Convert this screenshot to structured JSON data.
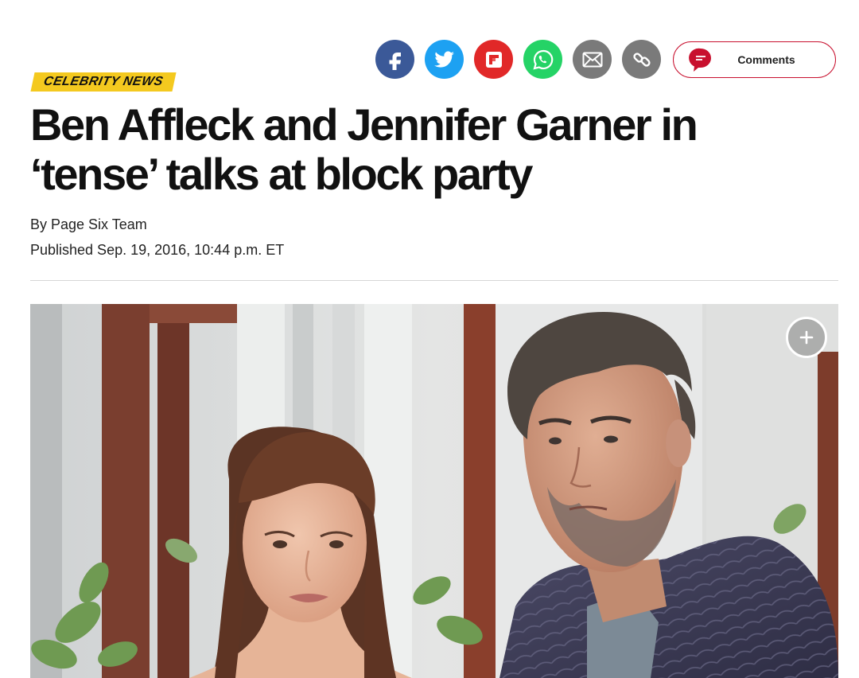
{
  "share": {
    "buttons": [
      {
        "name": "facebook",
        "color": "#3b5998",
        "icon": "facebook-icon"
      },
      {
        "name": "twitter",
        "color": "#1da1f2",
        "icon": "twitter-icon"
      },
      {
        "name": "flipboard",
        "color": "#e12828",
        "icon": "flipboard-icon"
      },
      {
        "name": "whatsapp",
        "color": "#25d366",
        "icon": "whatsapp-icon"
      },
      {
        "name": "email",
        "color": "#7a7a7a",
        "icon": "envelope-icon"
      },
      {
        "name": "copy-link",
        "color": "#7a7a7a",
        "icon": "link-icon"
      }
    ],
    "comments_label": "Comments",
    "comments_color": "#c8102e"
  },
  "article": {
    "category": "CELEBRITY NEWS",
    "category_color": "#f4c91f",
    "headline": "Ben Affleck and Jennifer Garner in ‘tense’ talks at block party",
    "byline_prefix": "By ",
    "author": "Page Six Team",
    "published": "Published Sep. 19, 2016, 10:44 p.m. ET"
  },
  "photo": {
    "subject": "Jennifer Garner and Ben Affleck outdoors",
    "expand_icon": "plus-icon"
  }
}
